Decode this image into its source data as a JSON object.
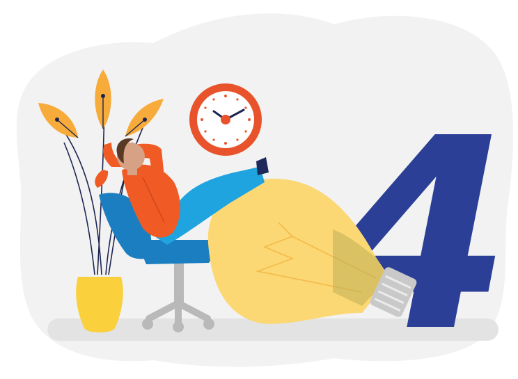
{
  "illustration": {
    "big_number": "4",
    "icons": {
      "clock": "clock-icon",
      "lightbulb": "lightbulb-icon",
      "plant": "plant-icon",
      "chair": "office-chair-icon",
      "person": "relaxing-person-icon"
    },
    "colors": {
      "background_blob": "#f2f2f2",
      "floor_shadow": "#e3e3e3",
      "number": "#2b3f96",
      "bulb_glass": "#fbd873",
      "bulb_outline": "#f3b94c",
      "bulb_base": "#c9c9c9",
      "clock_ring": "#e9532b",
      "clock_face": "#ffffff",
      "shirt": "#f05a24",
      "pants": "#1fa4df",
      "chair_seat": "#1b7ec0",
      "chair_frame": "#b9b9b9",
      "skin": "#d6a184",
      "hair": "#5a3826",
      "shoe": "#1f2a5a",
      "vase": "#fad03c",
      "leaf": "#f7ab3a",
      "stem": "#1c2451"
    }
  }
}
